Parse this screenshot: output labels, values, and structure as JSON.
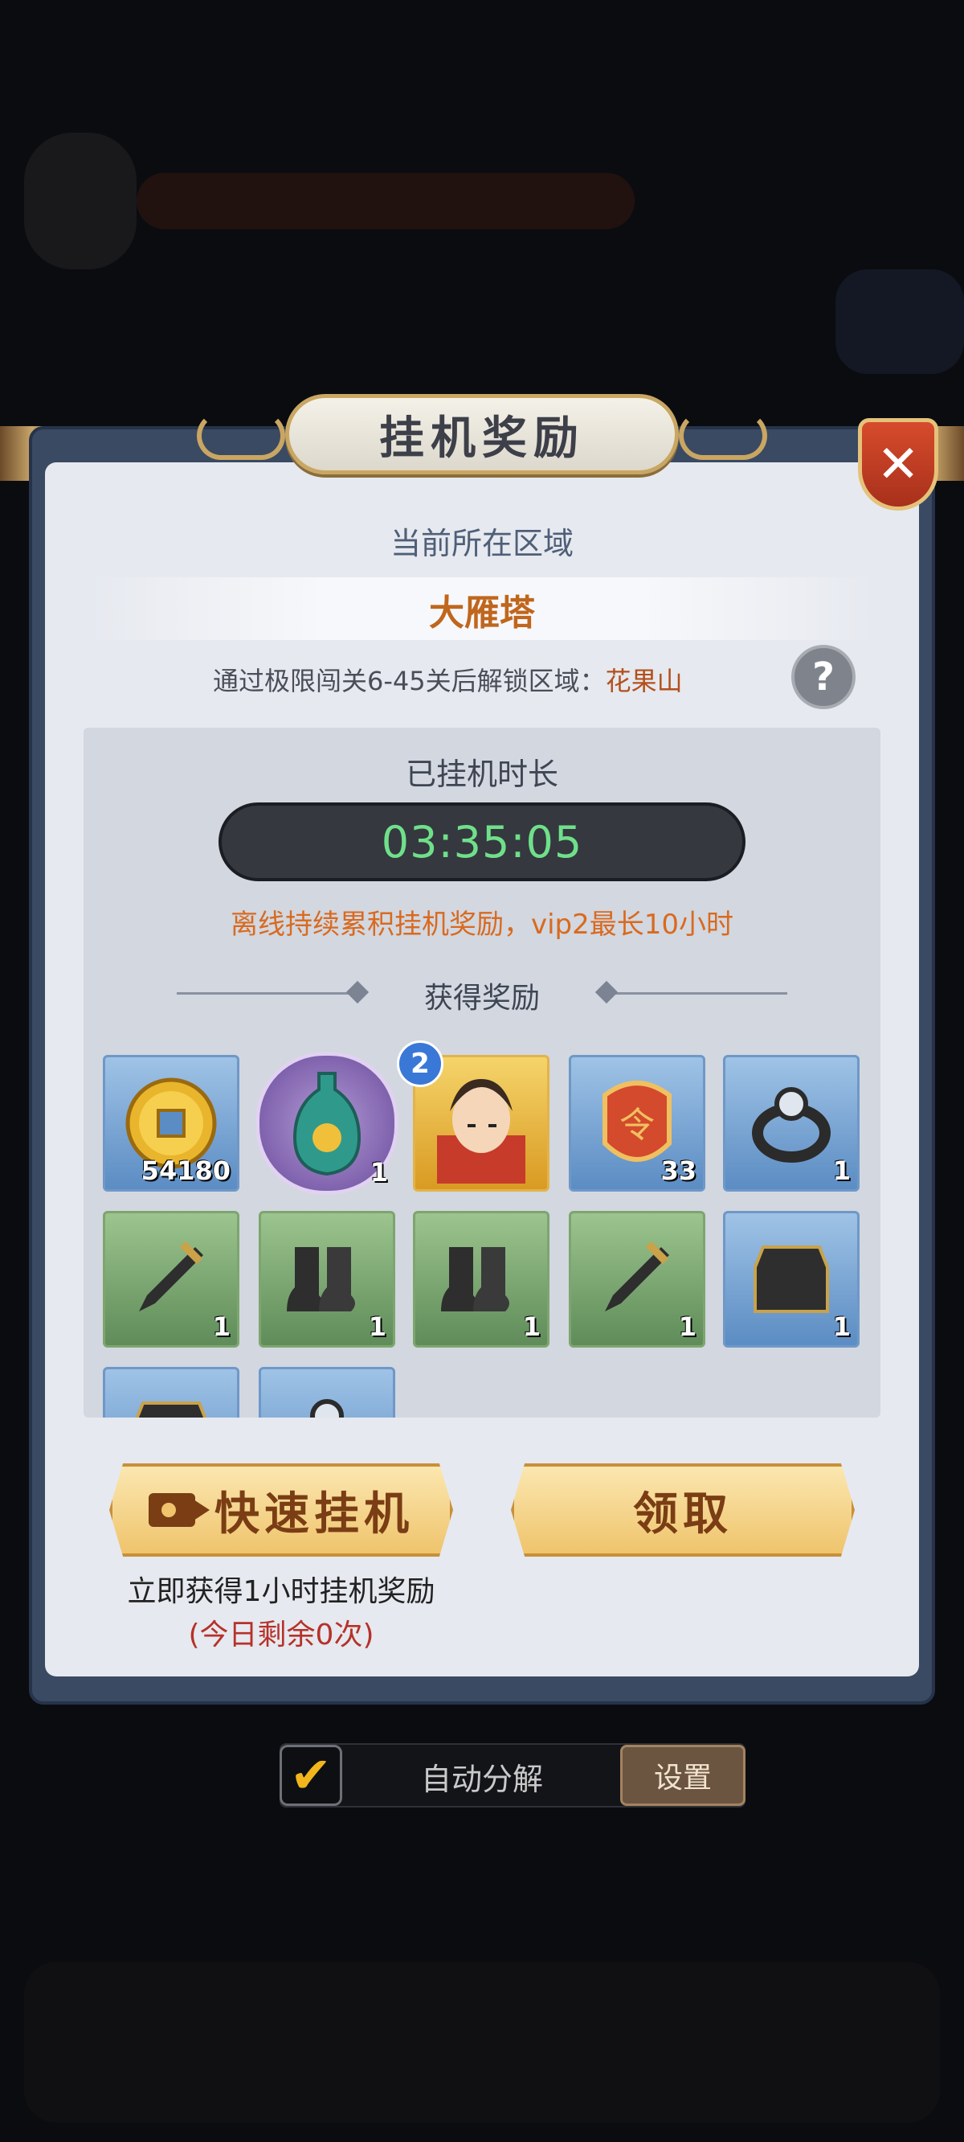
{
  "dialog": {
    "title": "挂机奖励",
    "close_icon": "close-icon",
    "region_label": "当前所在区域",
    "region_name": "大雁塔",
    "unlock_text": "通过极限闯关6-45关后解锁区域：",
    "unlock_region": "花果山",
    "help_symbol": "?"
  },
  "afk": {
    "label": "已挂机时长",
    "duration": "03:35:05",
    "offline_note": "离线持续累积挂机奖励，vip2最长10小时"
  },
  "rewards": {
    "header": "获得奖励",
    "hero_badge": "2",
    "items": [
      {
        "icon": "coin-icon",
        "qty": "54180"
      },
      {
        "icon": "vase-icon",
        "qty": "1"
      },
      {
        "icon": "hero-portrait-icon",
        "qty": ""
      },
      {
        "icon": "token-icon",
        "qty": "33"
      },
      {
        "icon": "ring-icon",
        "qty": "1"
      },
      {
        "icon": "sword-icon",
        "qty": "1"
      },
      {
        "icon": "boots-icon",
        "qty": "1"
      },
      {
        "icon": "boots-icon",
        "qty": "1"
      },
      {
        "icon": "sword-icon",
        "qty": "1"
      },
      {
        "icon": "armor-icon",
        "qty": "1"
      },
      {
        "icon": "armor-icon",
        "qty": ""
      },
      {
        "icon": "ring-icon",
        "qty": ""
      }
    ]
  },
  "actions": {
    "quick_label": "快速挂机",
    "claim_label": "领取",
    "quick_desc": "立即获得1小时挂机奖励",
    "quick_remaining": "(今日剩余0次)"
  },
  "auto_decompose": {
    "checked_symbol": "✔",
    "label": "自动分解",
    "settings_label": "设置"
  },
  "colors": {
    "timer_text": "#6fe08a",
    "region_name": "#c0661d",
    "offline_note": "#d96a1f",
    "remaining": "#b5322a"
  }
}
